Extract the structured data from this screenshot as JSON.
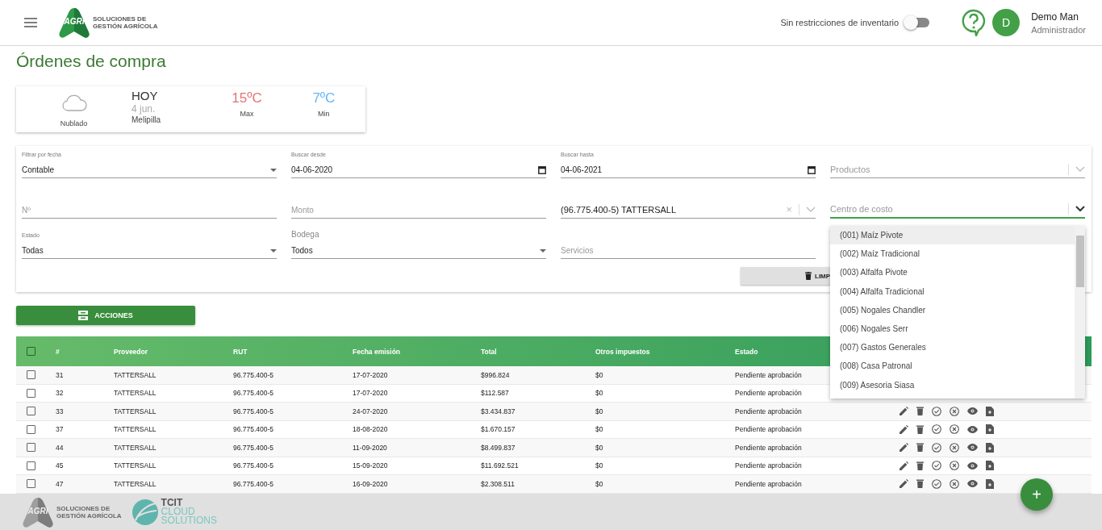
{
  "header": {
    "logo": {
      "mark": "AGRI",
      "lines": [
        "SOLUCIONES DE",
        "GESTIÓN AGRÍCOLA"
      ]
    },
    "inventory_toggle": {
      "label": "Sin restricciones de inventario",
      "on": false
    },
    "user": {
      "initial": "D",
      "name": "Demo Man",
      "role": "Administrador"
    }
  },
  "page_title": "Órdenes de compra",
  "weather": {
    "condition": "Nublado",
    "day": "HOY",
    "date": "4 jun.",
    "place": "Melipilla",
    "max": "15ºC",
    "max_label": "Max",
    "min": "7ºC",
    "min_label": "Min"
  },
  "filters": [
    {
      "kind": "select",
      "label": "Filtrar por fecha",
      "value": "Contable"
    },
    {
      "kind": "date",
      "label": "Buscar desde",
      "value": "04-06-2020"
    },
    {
      "kind": "date",
      "label": "Buscar hasta",
      "value": "04-06-2021"
    },
    {
      "kind": "combo",
      "placeholder": "Productos",
      "focused": false
    },
    {
      "kind": "text",
      "placeholder": "Nº"
    },
    {
      "kind": "text",
      "placeholder": "Monto"
    },
    {
      "kind": "combo",
      "value": "(96.775.400-5) TATTERSALL",
      "clear_icon": "×",
      "focused": false
    },
    {
      "kind": "combo",
      "placeholder": "Centro de costo",
      "focused": true
    },
    {
      "kind": "select",
      "label": "Estado",
      "value": "Todas"
    },
    {
      "kind": "select",
      "label": "Bodega",
      "value": "Todos"
    },
    {
      "kind": "text",
      "placeholder": "Servicios"
    }
  ],
  "clear_button": "LIMP",
  "dropdown": {
    "items": [
      {
        "label": "(001) Maíz Pivote",
        "selected": true
      },
      {
        "label": "(002) Maíz Tradicional",
        "selected": false
      },
      {
        "label": "(003) Alfalfa Pivote",
        "selected": false
      },
      {
        "label": "(004) Alfalfa Tradicional",
        "selected": false
      },
      {
        "label": "(005) Nogales Chandler",
        "selected": false
      },
      {
        "label": "(006) Nogales Serr",
        "selected": false
      },
      {
        "label": "(007) Gastos Generales",
        "selected": false
      },
      {
        "label": "(008) Casa Patronal",
        "selected": false
      },
      {
        "label": "(009) Asesoria Siasa",
        "selected": false
      }
    ]
  },
  "actions_button": "ACCIONES",
  "table": {
    "select_all": false,
    "columns": [
      "#",
      "Proveedor",
      "RUT",
      "Fecha emisión",
      "Total",
      "Otros impuestos",
      "Estado"
    ],
    "rows": [
      {
        "checked": false,
        "actions": false,
        "cells": [
          "31",
          "TATTERSALL",
          "96.775.400-5",
          "17-07-2020",
          "$996.824",
          "$0",
          "Pendiente aprobación"
        ]
      },
      {
        "checked": false,
        "actions": false,
        "cells": [
          "32",
          "TATTERSALL",
          "96.775.400-5",
          "17-07-2020",
          "$112.587",
          "$0",
          "Pendiente aprobación"
        ]
      },
      {
        "checked": false,
        "actions": true,
        "cells": [
          "33",
          "TATTERSALL",
          "96.775.400-5",
          "24-07-2020",
          "$3.434.837",
          "$0",
          "Pendiente aprobación"
        ]
      },
      {
        "checked": false,
        "actions": true,
        "cells": [
          "37",
          "TATTERSALL",
          "96.775.400-5",
          "18-08-2020",
          "$1.670.157",
          "$0",
          "Pendiente aprobación"
        ]
      },
      {
        "checked": false,
        "actions": true,
        "cells": [
          "44",
          "TATTERSALL",
          "96.775.400-5",
          "11-09-2020",
          "$8.499.837",
          "$0",
          "Pendiente aprobación"
        ]
      },
      {
        "checked": false,
        "actions": true,
        "cells": [
          "45",
          "TATTERSALL",
          "96.775.400-5",
          "15-09-2020",
          "$11.692.521",
          "$0",
          "Pendiente aprobación"
        ]
      },
      {
        "checked": false,
        "actions": true,
        "cells": [
          "47",
          "TATTERSALL",
          "96.775.400-5",
          "16-09-2020",
          "$2.308.511",
          "$0",
          "Pendiente aprobación"
        ]
      }
    ]
  },
  "footer": {
    "logo": {
      "mark": "AGRI",
      "lines": [
        "SOLUCIONES DE",
        "GESTIÓN AGRÍCOLA"
      ]
    },
    "partner": {
      "name": "TCIT",
      "lines": [
        "CLOUD",
        "SOLUTIONS"
      ]
    }
  },
  "fab": "+"
}
